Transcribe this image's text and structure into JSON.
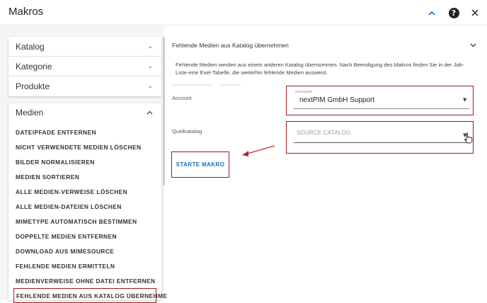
{
  "app": {
    "title": "Makros"
  },
  "toolbar": {
    "collapse_icon": "chevron-up",
    "help_icon": "?",
    "close_icon": "✕"
  },
  "sidebar": {
    "categories": [
      {
        "label": "Katalog"
      },
      {
        "label": "Kategorie"
      },
      {
        "label": "Produkte"
      }
    ],
    "medien": {
      "label": "Medien",
      "items": [
        {
          "label": "DATEIPFADE ENTFERNEN"
        },
        {
          "label": "NICHT VERWENDETE MEDIEN LÖSCHEN"
        },
        {
          "label": "BILDER NORMALISIEREN"
        },
        {
          "label": "MEDIEN SORTIEREN"
        },
        {
          "label": "ALLE MEDIEN-VERWEISE LÖSCHEN"
        },
        {
          "label": "ALLE MEDIEN-DATEIEN LÖSCHEN"
        },
        {
          "label": "MIMETYPE AUTOMATISCH BESTIMMEN"
        },
        {
          "label": "DOPPELTE MEDIEN ENTFERNEN"
        },
        {
          "label": "DOWNLOAD AUS MIMESOURCE"
        },
        {
          "label": "FEHLENDE MEDIEN ERMITTELN"
        },
        {
          "label": "MEDIENVERWEISE OHNE DATEI ENTFERNEN"
        },
        {
          "label": "FEHLENDE MEDIEN AUS KATALOG ÜBERNEHMEN"
        }
      ]
    }
  },
  "main": {
    "section_title": "Fehlende Medien aus Katalog übernehmen",
    "description": "Fehlende Medien werden aus einem anderen Katalog übernommen. Nach Beendigung des Makros finden Sie in der Job-Liste eine Exel-Tabelle, die weiterhin fehlende Medien ausweist.",
    "account": {
      "label": "Account",
      "small_label": "ACCOUNT",
      "value": "nextPIM GmbH Support"
    },
    "source": {
      "label": "Quellcatalog",
      "placeholder": "SOURCE CATALOG"
    },
    "start_button": "STARTE MAKRO"
  },
  "colors": {
    "accent": "#1a6fb8",
    "highlight": "#a3191c"
  }
}
